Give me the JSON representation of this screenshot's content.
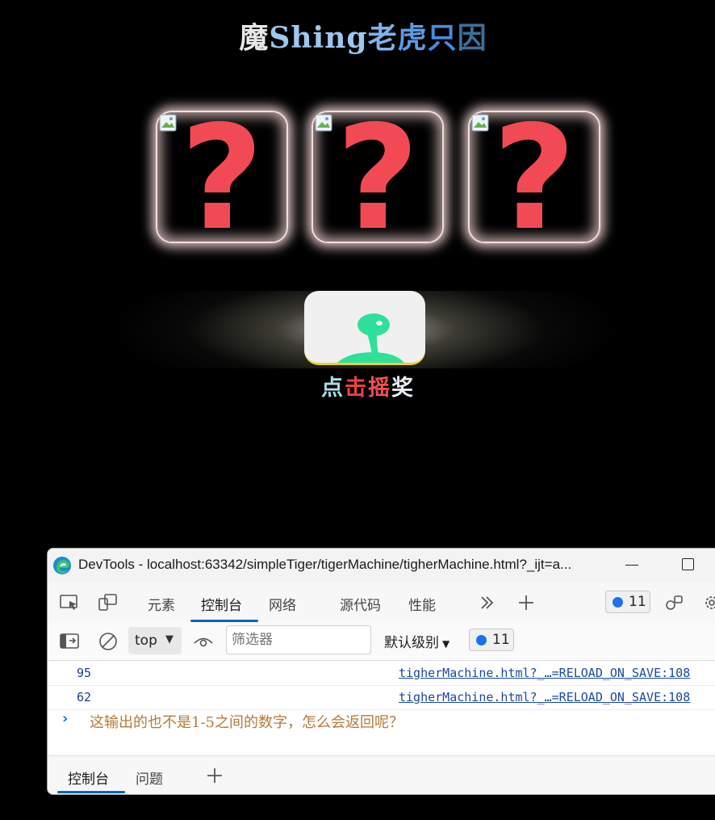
{
  "page": {
    "title_chars": [
      "魔",
      "Shing",
      "老",
      "虎",
      "只",
      "因"
    ],
    "slots": [
      {
        "symbol": "?"
      },
      {
        "symbol": "?"
      },
      {
        "symbol": "?"
      }
    ],
    "lever_label_chars": [
      "点",
      "击",
      "摇",
      "奖"
    ]
  },
  "devtools": {
    "window_title": "DevTools - localhost:63342/simpleTiger/tigerMachine/tigherMachine.html?_ijt=a...",
    "tabs": [
      {
        "label": "元素"
      },
      {
        "label": "控制台"
      },
      {
        "label": "网络"
      },
      {
        "label": "源代码"
      },
      {
        "label": "性能"
      }
    ],
    "active_tab": "控制台",
    "message_count": "11",
    "toolbar": {
      "context": "top",
      "filter_placeholder": "筛选器",
      "level": "默认级别",
      "message_count": "11"
    },
    "logs": [
      {
        "value": "95",
        "source": "tigherMachine.html?_…=RELOAD_ON_SAVE:108"
      },
      {
        "value": "62",
        "source": "tigherMachine.html?_…=RELOAD_ON_SAVE:108"
      }
    ],
    "prompt_text": "这输出的也不是1-5之间的数字，怎么会返回呢？",
    "drawer_tabs": [
      {
        "label": "控制台"
      },
      {
        "label": "问题"
      }
    ]
  }
}
